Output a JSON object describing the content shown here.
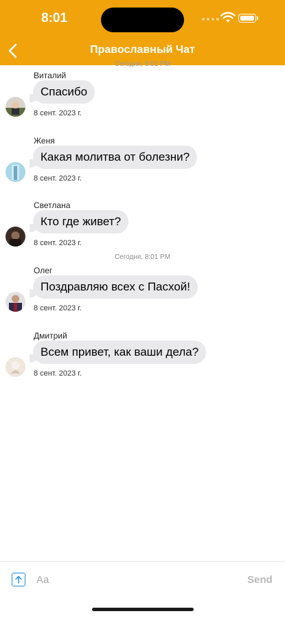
{
  "status": {
    "time": "8:01"
  },
  "header": {
    "title": "Православный Чат"
  },
  "messages": [
    {
      "sender": "Виталий",
      "text": "Спасибо",
      "date": "8 сент. 2023 г."
    },
    {
      "sender": "Женя",
      "text": "Какая молитва от болезни?",
      "date": "8 сент. 2023 г."
    },
    {
      "sender": "Светлана",
      "text": "Кто где живет?",
      "date": "8 сент. 2023 г."
    },
    {
      "sender": "Олег",
      "text": "Поздравляю всех с Пасхой!",
      "date": "8 сент. 2023 г."
    },
    {
      "sender": "Дмитрий",
      "text": "Всем привет, как ваши дела?",
      "date": "8 сент. 2023 г."
    }
  ],
  "separators": {
    "top_timestamp": "Сегодня, 8:01 PM",
    "day": "Сегодня, 8:01 PM"
  },
  "input": {
    "placeholder": "Aa",
    "value": "",
    "send_label": "Send"
  },
  "colors": {
    "header": "#f0a30a",
    "bubble": "#e9e9eb",
    "accent": "#1a8fe0"
  }
}
